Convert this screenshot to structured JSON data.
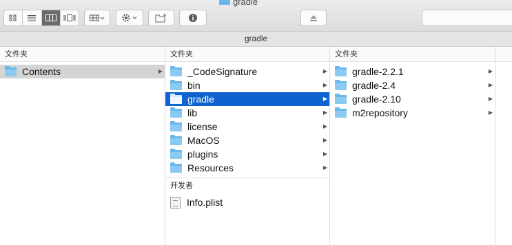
{
  "window": {
    "title": "gradle"
  },
  "pathbar": {
    "title": "gradle"
  },
  "columns": [
    {
      "header": "文件夹",
      "items": [
        {
          "label": "Contents",
          "state": "inactive-selected"
        }
      ]
    },
    {
      "header": "文件夹",
      "items": [
        {
          "label": "_CodeSignature"
        },
        {
          "label": "bin"
        },
        {
          "label": "gradle",
          "state": "selected"
        },
        {
          "label": "lib"
        },
        {
          "label": "license"
        },
        {
          "label": "MacOS"
        },
        {
          "label": "plugins"
        },
        {
          "label": "Resources"
        }
      ],
      "developer_section": {
        "header": "开发者",
        "items": [
          {
            "label": "Info.plist"
          }
        ]
      }
    },
    {
      "header": "文件夹",
      "items": [
        {
          "label": "gradle-2.2.1"
        },
        {
          "label": "gradle-2.4"
        },
        {
          "label": "gradle-2.10"
        },
        {
          "label": "m2repository"
        }
      ]
    }
  ],
  "colors": {
    "selection": "#0f63d0",
    "folder": "#6ab7ec",
    "inactive_selection": "#d4d4d4"
  },
  "icons": [
    "icon-view-icon",
    "list-view-icon",
    "column-view-icon",
    "cover-flow-icon",
    "arrange-icon",
    "gear-icon",
    "new-folder-icon",
    "info-icon",
    "eject-icon"
  ]
}
